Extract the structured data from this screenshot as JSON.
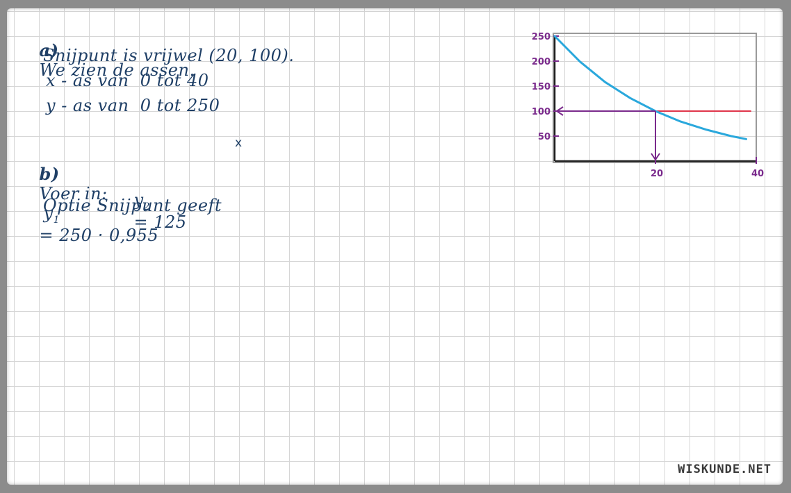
{
  "notes": {
    "a": {
      "label": "a)",
      "line1": "We zien de assen.",
      "line2": "Snijpunt is vrijwel (20, 100).",
      "line3": "x - as van  0 tot 40",
      "line4": "y - as van  0 tot 250"
    },
    "b": {
      "label": "b)",
      "voer_in": "Voer in:",
      "y1_var": "y",
      "y1_sub": "1",
      "y1_expr": "= 250 · 0,955",
      "y1_exp": "x",
      "y2_var": "y",
      "y2_sub": "2",
      "y2_expr": "= 125",
      "optie": "Optie Snijpunt geeft"
    }
  },
  "graph": {
    "y_ticks": [
      "250",
      "200",
      "150",
      "100",
      "50"
    ],
    "x_ticks": [
      "20",
      "40"
    ],
    "colors": {
      "curve": "#2aa8dc",
      "hline": "#e0354a",
      "arrows": "#7a2a8c",
      "axes": "#222222",
      "frame": "#9a9a9a"
    }
  },
  "chart_data": {
    "type": "line",
    "xlim": [
      0,
      40
    ],
    "ylim": [
      0,
      250
    ],
    "series": [
      {
        "x": [
          0,
          5,
          10,
          15,
          20,
          25,
          30,
          35,
          38
        ],
        "values": [
          250,
          199,
          158,
          126,
          100,
          79,
          63,
          50,
          44
        ]
      },
      {
        "x": [
          20,
          39
        ],
        "values": [
          100,
          100
        ]
      }
    ],
    "intersection": [
      20,
      100
    ],
    "x_tick_values": [
      20,
      40
    ],
    "y_tick_values": [
      250,
      200,
      150,
      100,
      50
    ]
  },
  "footer": {
    "brand": "WISKUNDE.NET"
  }
}
